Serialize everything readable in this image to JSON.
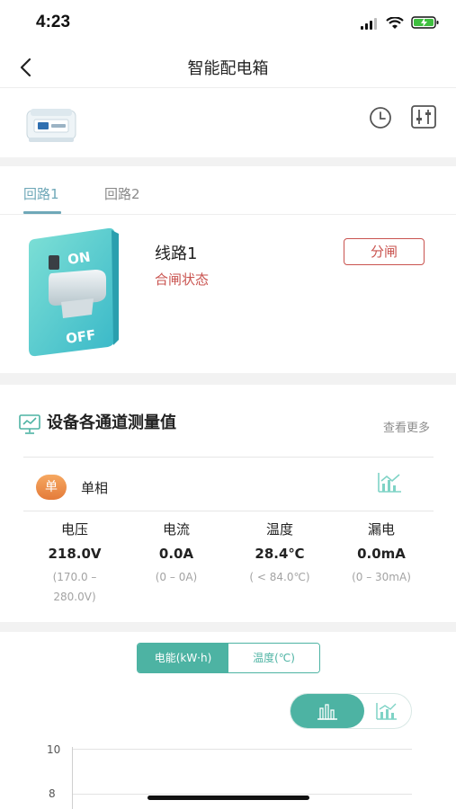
{
  "status_bar": {
    "time": "4:23"
  },
  "nav": {
    "title": "智能配电箱"
  },
  "tabs": [
    {
      "label": "回路1",
      "active": true
    },
    {
      "label": "回路2",
      "active": false
    }
  ],
  "breaker": {
    "name": "线路1",
    "status": "合闸状态",
    "action_label": "分闸"
  },
  "measurements": {
    "title": "设备各通道测量值",
    "see_more": "查看更多",
    "phase_badge": "单",
    "phase_label": "单相",
    "metrics": [
      {
        "label": "电压",
        "value": "218.0V",
        "range_line1": "(170.0 –",
        "range_line2": "280.0V)"
      },
      {
        "label": "电流",
        "value": "0.0A",
        "range_line1": "(0 – 0A)",
        "range_line2": ""
      },
      {
        "label": "温度",
        "value": "28.4℃",
        "range_line1": "( < 84.0℃)",
        "range_line2": ""
      },
      {
        "label": "漏电",
        "value": "0.0mA",
        "range_line1": "(0 – 30mA)",
        "range_line2": ""
      }
    ]
  },
  "chart_controls": {
    "segments": [
      {
        "label": "电能(kW·h)",
        "active": true
      },
      {
        "label": "温度(℃)",
        "active": false
      }
    ],
    "chart_types": [
      {
        "icon": "bar-chart-icon",
        "active": true
      },
      {
        "icon": "line-chart-icon",
        "active": false
      }
    ]
  },
  "chart_data": {
    "type": "bar",
    "title": "",
    "xlabel": "",
    "ylabel": "",
    "y_ticks": [
      "10",
      "8"
    ],
    "categories": [],
    "values": [],
    "grid": true
  },
  "colors": {
    "accent": "#4db3a3",
    "tab_active": "#6fa8b8",
    "warning": "#c9534f",
    "badge": "#e47b3a"
  }
}
